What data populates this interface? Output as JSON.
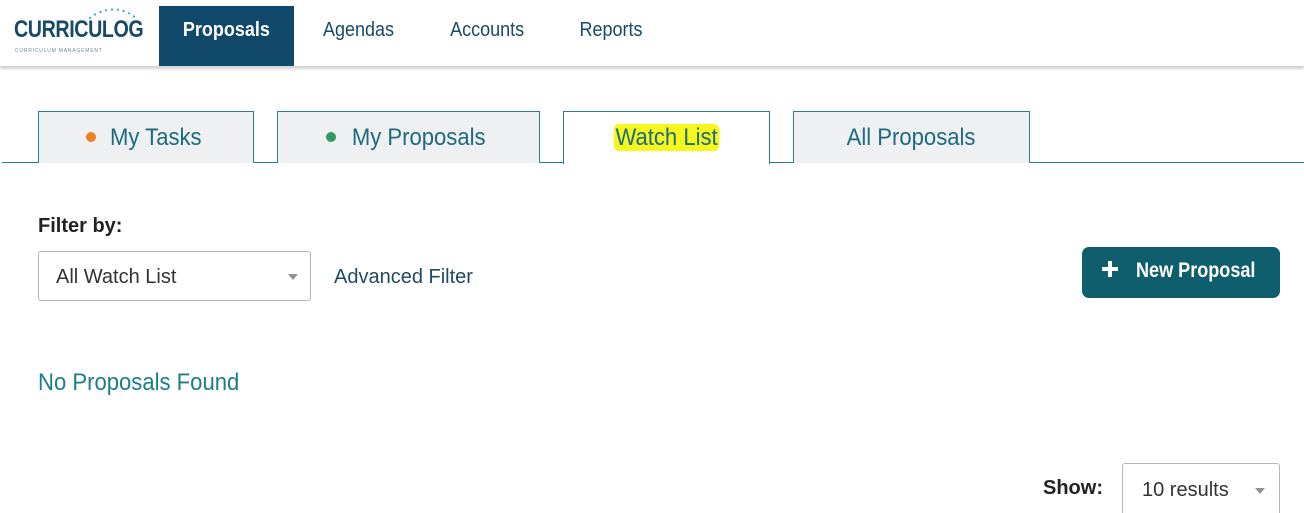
{
  "brand": {
    "name": "CURRICULOG",
    "tagline": "CURRICULUM MANAGEMENT",
    "color": "#174a66"
  },
  "nav": {
    "items": [
      {
        "label": "Proposals",
        "active": true
      },
      {
        "label": "Agendas",
        "active": false
      },
      {
        "label": "Accounts",
        "active": false
      },
      {
        "label": "Reports",
        "active": false
      }
    ]
  },
  "tabs": [
    {
      "label": "My Tasks",
      "dot_color": "#f07f1f",
      "active": false
    },
    {
      "label": "My Proposals",
      "dot_color": "#2f9a61",
      "active": false
    },
    {
      "label": "Watch List",
      "active": true,
      "highlighted": true
    },
    {
      "label": "All Proposals",
      "active": false
    }
  ],
  "filter": {
    "label": "Filter by:",
    "selected": "All Watch List",
    "advanced_link": "Advanced Filter"
  },
  "actions": {
    "new_proposal_label": "New Proposal"
  },
  "results": {
    "empty_message": "No Proposals Found",
    "show_label": "Show:",
    "page_size_selected": "10 results"
  },
  "colors": {
    "nav_active_bg": "#0f4869",
    "accent_teal": "#1c7f86",
    "button_bg": "#0f5e6e",
    "highlight": "#f6f71c"
  },
  "icons": {
    "plus": "plus-icon",
    "caret": "chevron-down-icon"
  }
}
